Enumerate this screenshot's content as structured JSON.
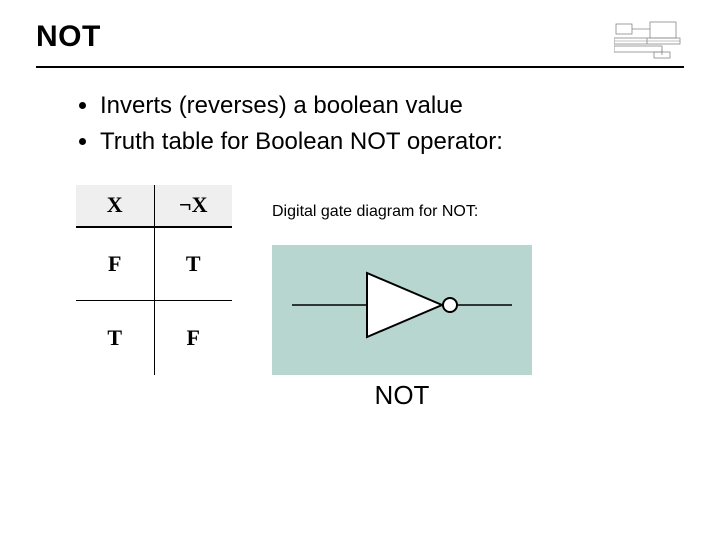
{
  "title": "NOT",
  "bullets": [
    "Inverts (reverses) a boolean value",
    "Truth table for Boolean NOT operator:"
  ],
  "truth_table": {
    "headers": [
      "X",
      "¬X"
    ],
    "rows": [
      [
        "F",
        "T"
      ],
      [
        "T",
        "F"
      ]
    ]
  },
  "diagram": {
    "caption": "Digital gate diagram for NOT:",
    "label": "NOT"
  },
  "chart_data": {
    "type": "table",
    "title": "Truth table for Boolean NOT operator",
    "columns": [
      "X",
      "¬X"
    ],
    "rows": [
      [
        "F",
        "T"
      ],
      [
        "T",
        "F"
      ]
    ]
  }
}
